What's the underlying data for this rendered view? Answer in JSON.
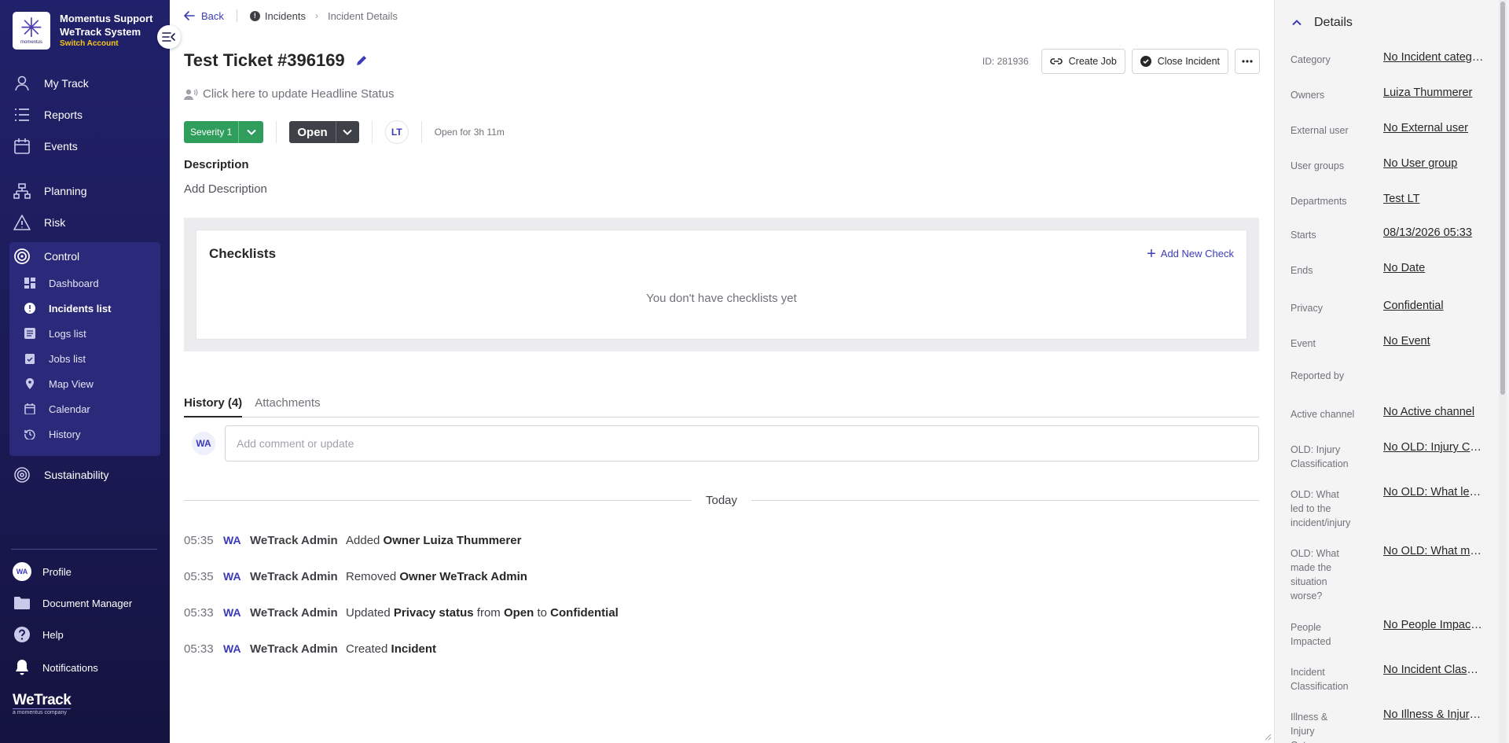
{
  "sidebar": {
    "brand_line1": "Momentus Support",
    "brand_line2": "WeTrack System",
    "switch_account": "Switch Account",
    "logo_caption": "momentus",
    "nav": {
      "my_track": "My Track",
      "reports": "Reports",
      "events": "Events",
      "planning": "Planning",
      "risk": "Risk",
      "control": "Control",
      "sustainability": "Sustainability"
    },
    "control_items": {
      "dashboard": "Dashboard",
      "incidents": "Incidents list",
      "logs": "Logs list",
      "jobs": "Jobs list",
      "map": "Map View",
      "calendar": "Calendar",
      "history": "History"
    },
    "bottom": {
      "profile_initials": "WA",
      "profile": "Profile",
      "documents": "Document Manager",
      "help": "Help",
      "notifications": "Notifications"
    },
    "footer_logo": "WeTrack",
    "footer_tagline": "a momentus company"
  },
  "topbar": {
    "back": "Back",
    "crumb_incidents": "Incidents",
    "crumb_current": "Incident Details"
  },
  "incident": {
    "title": "Test Ticket #396169",
    "headline_placeholder": "Click here to update Headline Status",
    "id_label": "ID: 281936",
    "create_job": "Create Job",
    "close_incident": "Close Incident",
    "severity": "Severity 1",
    "status": "Open",
    "assignee_initials": "LT",
    "open_for": "Open for 3h 11m",
    "description_heading": "Description",
    "description_add": "Add Description"
  },
  "checklists": {
    "title": "Checklists",
    "add": "Add New Check",
    "empty": "You don't have checklists yet"
  },
  "tabs": {
    "history": "History (4)",
    "attachments": "Attachments"
  },
  "comment": {
    "avatar": "WA",
    "placeholder": "Add comment or update"
  },
  "history": {
    "day": "Today",
    "entries": [
      {
        "time": "05:35",
        "avatar": "WA",
        "user": "WeTrack Admin",
        "action": "Added",
        "bold1": "Owner Luiza Thummerer",
        "mid": "",
        "bold2": "",
        "mid2": "",
        "bold3": ""
      },
      {
        "time": "05:35",
        "avatar": "WA",
        "user": "WeTrack Admin",
        "action": "Removed",
        "bold1": "Owner WeTrack Admin",
        "mid": "",
        "bold2": "",
        "mid2": "",
        "bold3": ""
      },
      {
        "time": "05:33",
        "avatar": "WA",
        "user": "WeTrack Admin",
        "action": "Updated",
        "bold1": "Privacy status",
        "mid": "from",
        "bold2": "Open",
        "mid2": "to",
        "bold3": "Confidential"
      },
      {
        "time": "05:33",
        "avatar": "WA",
        "user": "WeTrack Admin",
        "action": "Created",
        "bold1": "Incident",
        "mid": "",
        "bold2": "",
        "mid2": "",
        "bold3": ""
      }
    ]
  },
  "details": {
    "heading": "Details",
    "rows": [
      {
        "label": "Category",
        "value": "No Incident category"
      },
      {
        "label": "Owners",
        "value": "Luiza Thummerer"
      },
      {
        "label": "External user",
        "value": "No External user"
      },
      {
        "label": "User groups",
        "value": "No User group"
      },
      {
        "label": "Departments",
        "value": "Test LT"
      },
      {
        "label": "Starts",
        "value": "08/13/2026 05:33"
      },
      {
        "label": "Ends",
        "value": "No Date"
      },
      {
        "label": "Privacy",
        "value": "Confidential"
      },
      {
        "label": "Event",
        "value": "No Event"
      },
      {
        "label": "Reported by",
        "value": ""
      },
      {
        "label": "Active channel",
        "value": "No Active channel"
      },
      {
        "label": "OLD: Injury Classification",
        "value": "No OLD: Injury Classification"
      },
      {
        "label": "OLD: What led to the incident/injury",
        "value": "No OLD: What led to the incident/injury"
      },
      {
        "label": "OLD: What made the situation worse?",
        "value": "No OLD: What made the situation worse?"
      },
      {
        "label": "People Impacted",
        "value": "No People Impacted"
      },
      {
        "label": "Incident Classification",
        "value": "No Incident Classification"
      },
      {
        "label": "Illness & Injury Category",
        "value": "No Illness & Injury Category"
      }
    ]
  }
}
